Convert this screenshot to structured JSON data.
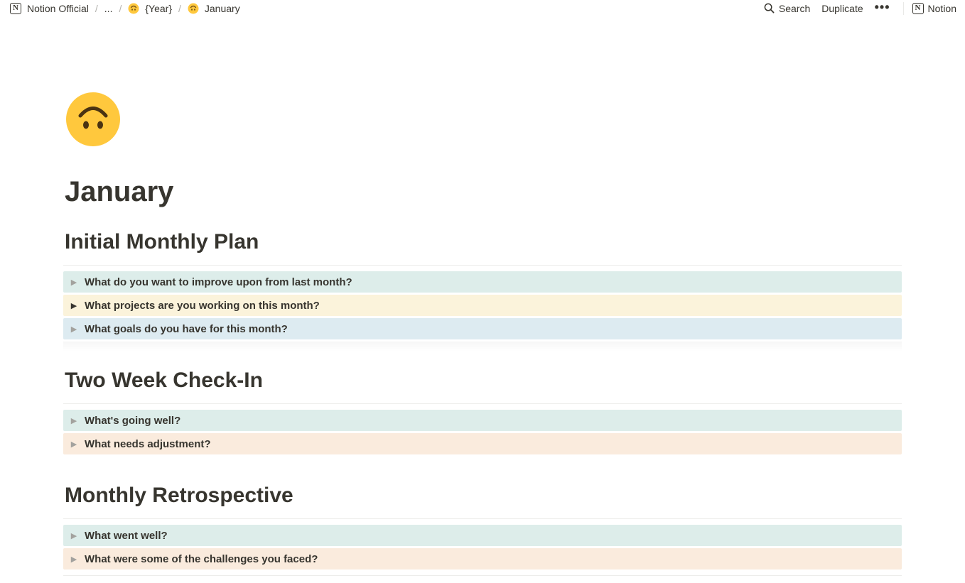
{
  "breadcrumb": {
    "items": [
      {
        "label": "Notion Official",
        "icon": "notion-logo-icon"
      },
      {
        "label": "...",
        "icon": ""
      },
      {
        "label": "{Year}",
        "icon": "upside-down-face-emoji-icon"
      },
      {
        "label": "January",
        "icon": "upside-down-face-emoji-icon"
      }
    ],
    "separator": "/"
  },
  "topbar": {
    "search_label": "Search",
    "duplicate_label": "Duplicate",
    "more_label": "•••",
    "notion_label": "Notion",
    "notion_logo_letter": "N"
  },
  "page": {
    "icon": "upside-down-face-emoji-icon",
    "title": "January"
  },
  "sections": [
    {
      "heading": "Initial Monthly Plan",
      "toggles": [
        {
          "label": "What do you want to improve upon from last month?",
          "color": "#ddedea"
        },
        {
          "label": "What projects are you working on this month?",
          "color": "#fbf3db"
        },
        {
          "label": "What goals do you have for this month?",
          "color": "#ddebf1"
        }
      ]
    },
    {
      "heading": "Two Week Check-In",
      "toggles": [
        {
          "label": "What's going well?",
          "color": "#ddedea"
        },
        {
          "label": "What needs adjustment?",
          "color": "#faebdd"
        }
      ]
    },
    {
      "heading": "Monthly Retrospective",
      "toggles": [
        {
          "label": "What went well?",
          "color": "#ddedea"
        },
        {
          "label": "What were some of the challenges you faced?",
          "color": "#faebdd"
        }
      ]
    }
  ],
  "toggle_arrow": "▶",
  "colors": {
    "text": "#37352f",
    "green_bg": "#ddedea",
    "yellow_bg": "#fbf3db",
    "blue_bg": "#ddebf1",
    "orange_bg": "#faebdd",
    "emoji_yellow": "#ffc83d"
  }
}
